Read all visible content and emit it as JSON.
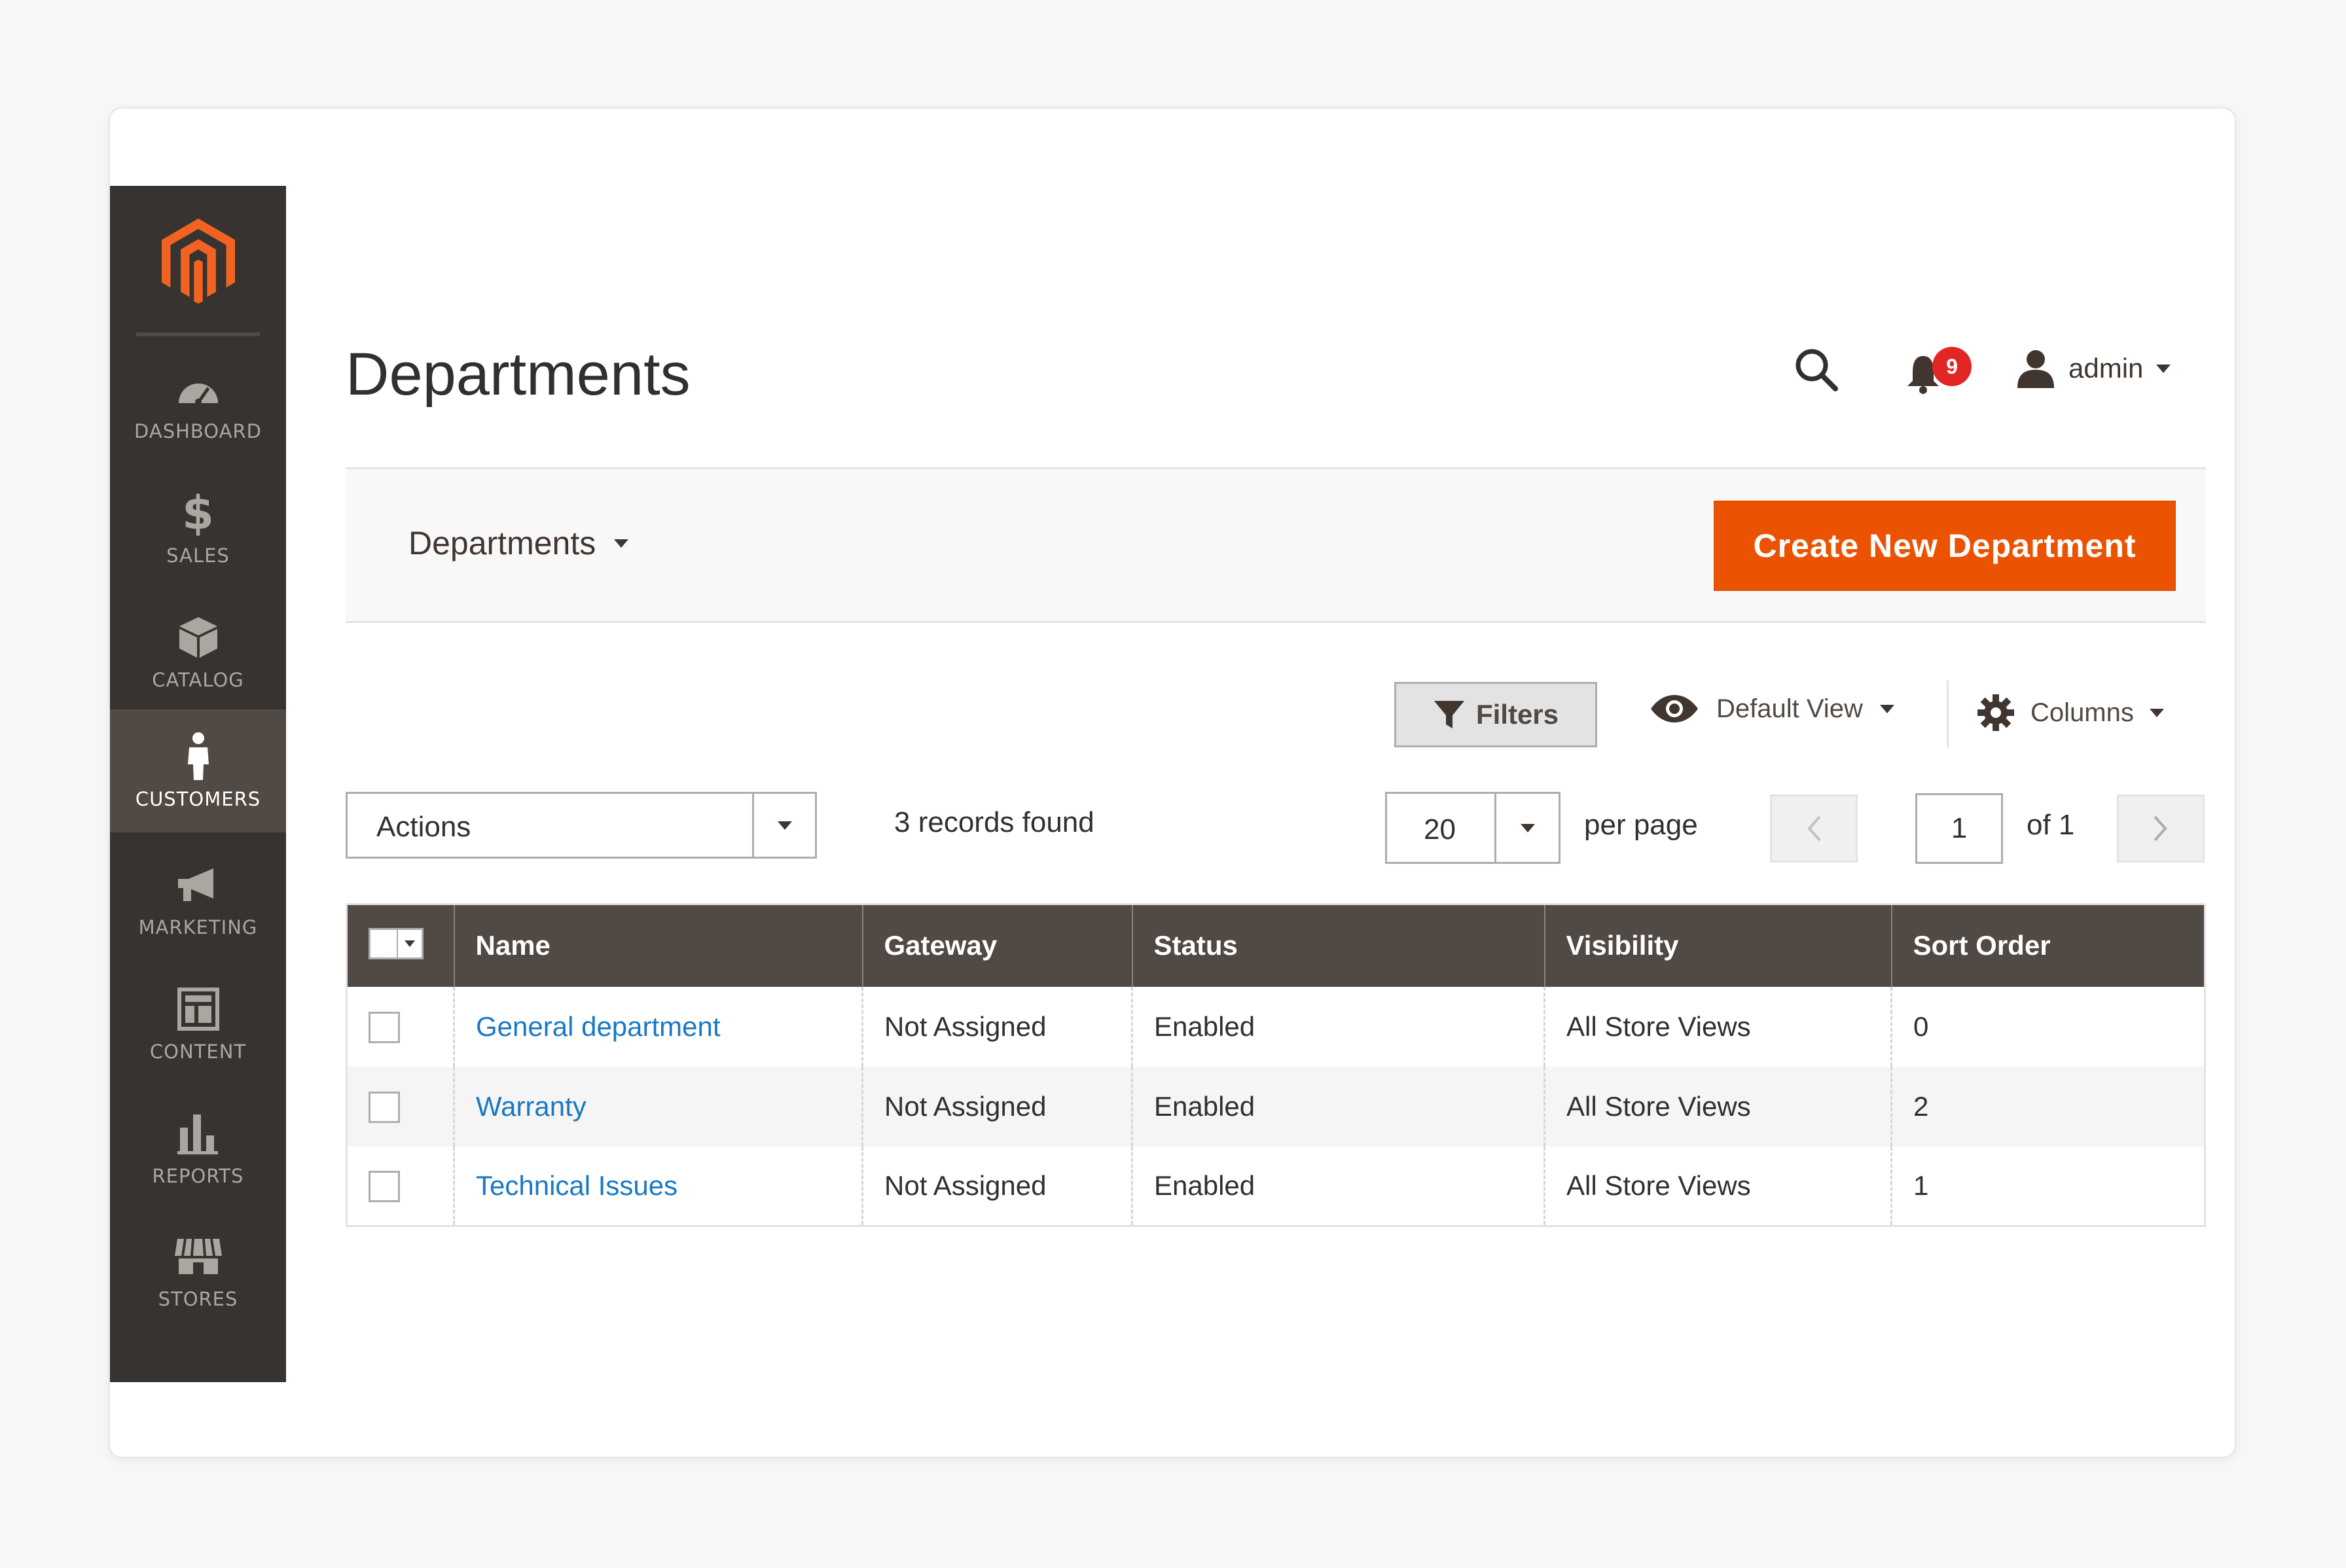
{
  "sidebar": {
    "logo": "magento-logo",
    "items": [
      {
        "label": "DASHBOARD",
        "icon": "dashboard-icon"
      },
      {
        "label": "SALES",
        "icon": "dollar-icon"
      },
      {
        "label": "CATALOG",
        "icon": "box-icon"
      },
      {
        "label": "CUSTOMERS",
        "icon": "person-icon",
        "active": true
      },
      {
        "label": "MARKETING",
        "icon": "megaphone-icon"
      },
      {
        "label": "CONTENT",
        "icon": "layout-icon"
      },
      {
        "label": "REPORTS",
        "icon": "bar-chart-icon"
      },
      {
        "label": "STORES",
        "icon": "store-icon"
      }
    ]
  },
  "header": {
    "title": "Departments",
    "notifications_count": "9",
    "user": "admin"
  },
  "page_actions": {
    "scope_label": "Departments",
    "primary_button": "Create New Department"
  },
  "toolbar": {
    "filters": "Filters",
    "view": "Default View",
    "columns": "Columns",
    "actions": "Actions",
    "records": "3 records found",
    "per_page_value": "20",
    "per_page_label": "per page",
    "current_page": "1",
    "of_pages": "of 1"
  },
  "grid": {
    "columns": [
      "Name",
      "Gateway",
      "Status",
      "Visibility",
      "Sort Order"
    ],
    "rows": [
      {
        "name": "General department",
        "gateway": "Not Assigned",
        "status": "Enabled",
        "visibility": "All Store Views",
        "sort_order": "0"
      },
      {
        "name": "Warranty",
        "gateway": "Not Assigned",
        "status": "Enabled",
        "visibility": "All Store Views",
        "sort_order": "2"
      },
      {
        "name": "Technical Issues",
        "gateway": "Not Assigned",
        "status": "Enabled",
        "visibility": "All Store Views",
        "sort_order": "1"
      }
    ]
  },
  "colors": {
    "accent": "#eb5202",
    "sidebar_bg": "#373330",
    "grid_header": "#514943",
    "link": "#1979c3"
  }
}
